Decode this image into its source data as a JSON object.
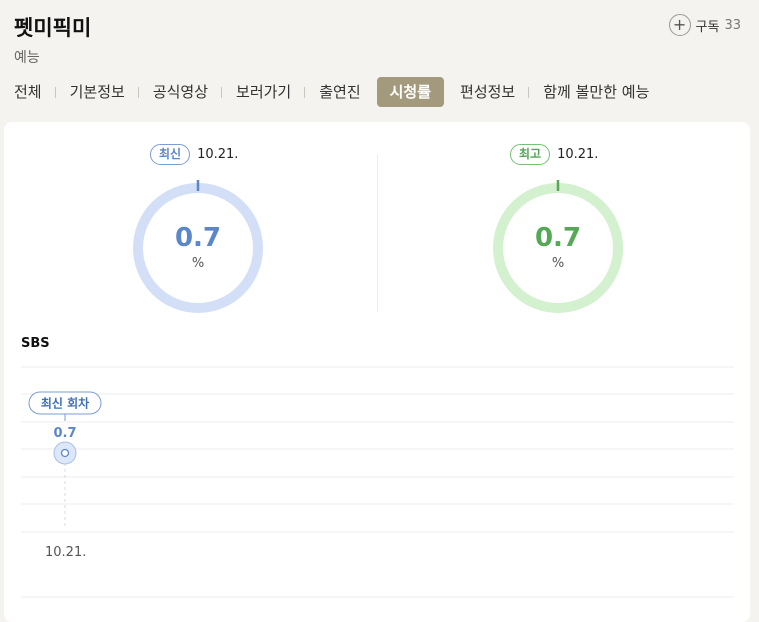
{
  "program": {
    "title": "펫미픽미",
    "genre": "예능"
  },
  "subscribe": {
    "label": "구독",
    "count": "33"
  },
  "tabs": [
    {
      "label": "전체",
      "active": false
    },
    {
      "label": "기본정보",
      "active": false
    },
    {
      "label": "공식영상",
      "active": false
    },
    {
      "label": "보러가기",
      "active": false
    },
    {
      "label": "출연진",
      "active": false
    },
    {
      "label": "시청률",
      "active": true
    },
    {
      "label": "편성정보",
      "active": false
    },
    {
      "label": "함께 볼만한 예능",
      "active": false
    }
  ],
  "ratings": {
    "latest": {
      "badge": "최신",
      "date": "10.21.",
      "value": "0.7",
      "unit": "%"
    },
    "highest": {
      "badge": "최고",
      "date": "10.21.",
      "value": "0.7",
      "unit": "%"
    }
  },
  "colors": {
    "accent_tab": "#a39a7e",
    "latest_blue": "#5b86c8",
    "latest_ring": "#d3dff7",
    "highest_green": "#55a855",
    "highest_ring": "#d3f0cf"
  },
  "chart_data": {
    "type": "line",
    "network": "SBS",
    "categories": [
      "10.21."
    ],
    "series": [
      {
        "values": [
          0.7
        ]
      }
    ],
    "annotation": {
      "label": "최신 회차",
      "value_label": "0.7",
      "x": "10.21."
    },
    "grid": true
  }
}
